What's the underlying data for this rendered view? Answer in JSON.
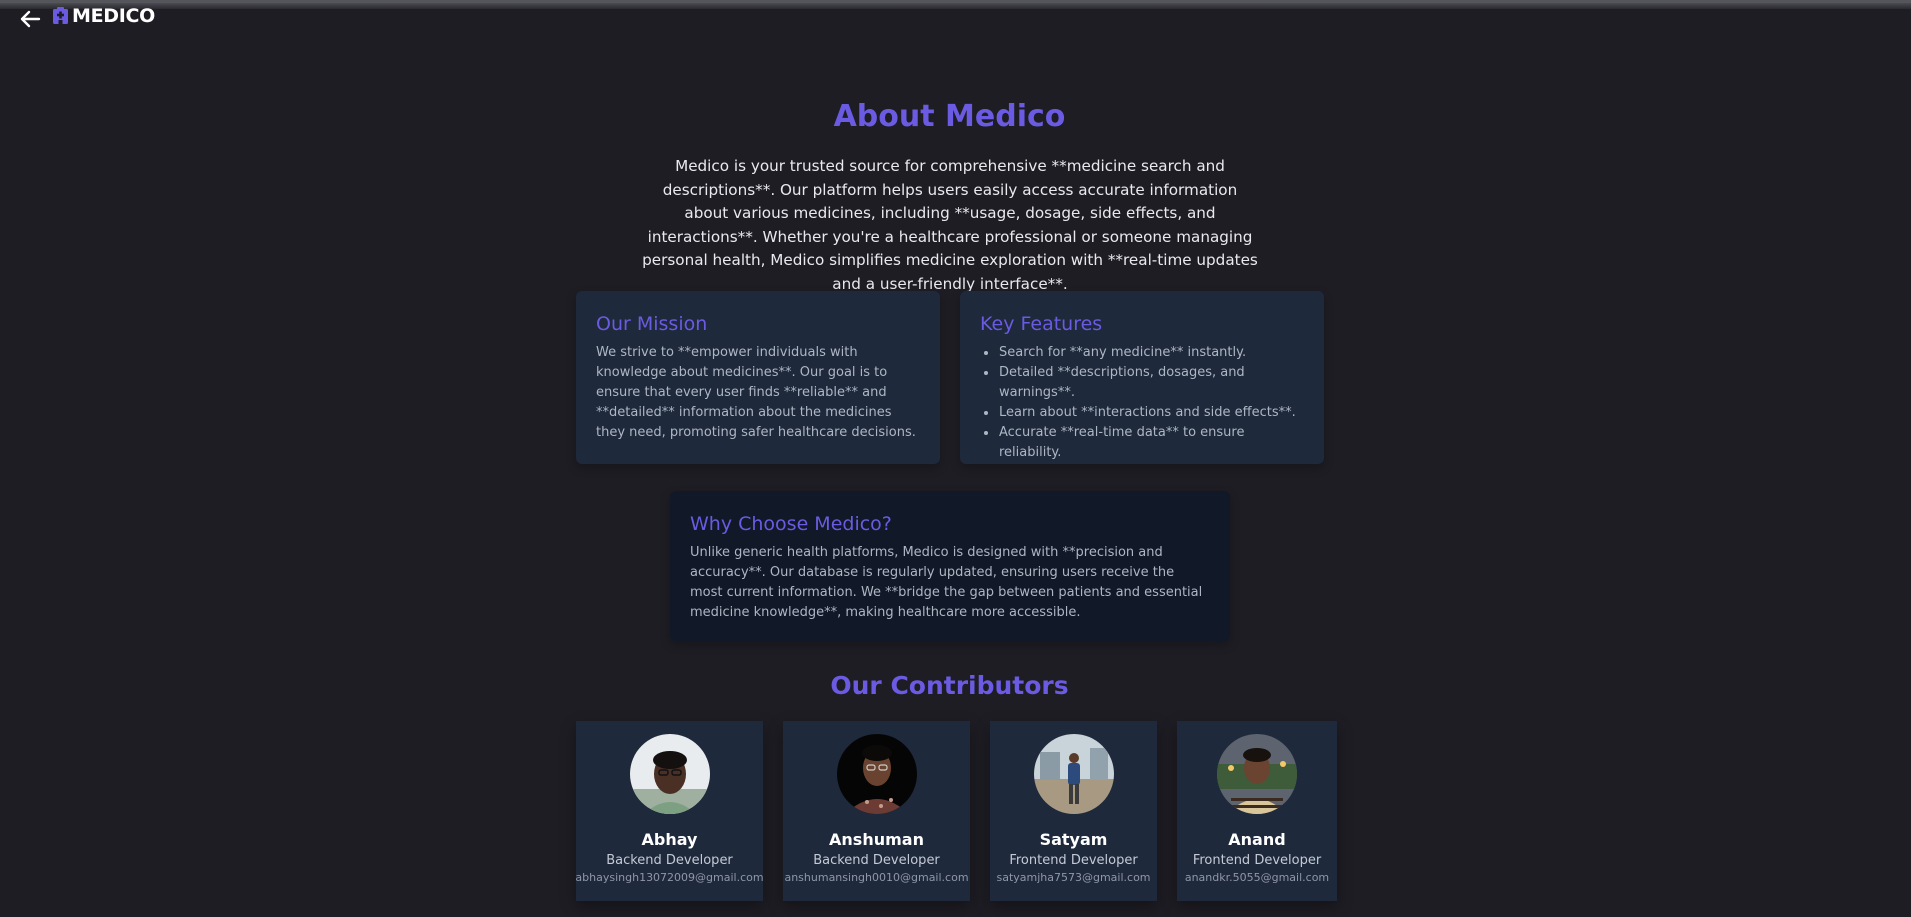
{
  "header": {
    "back_icon": "arrow-left-icon",
    "brand_icon": "hospital-icon",
    "brand_name": "MEDICO"
  },
  "about": {
    "title": "About Medico",
    "text": "Medico is your trusted source for comprehensive **medicine search and descriptions**. Our platform helps users easily access accurate information about various medicines, including **usage, dosage, side effects, and interactions**. Whether you're a healthcare professional or someone managing personal health, Medico simplifies medicine exploration with **real-time updates and a user-friendly interface**."
  },
  "mission": {
    "title": "Our Mission",
    "text": "We strive to **empower individuals with knowledge about medicines**. Our goal is to ensure that every user finds **reliable** and **detailed** information about the medicines they need, promoting safer healthcare decisions."
  },
  "features": {
    "title": "Key Features",
    "items": [
      "Search for **any medicine** instantly.",
      "Detailed **descriptions, dosages, and warnings**.",
      "Learn about **interactions and side effects**.",
      "Accurate **real-time data** to ensure reliability."
    ]
  },
  "why": {
    "title": "Why Choose Medico?",
    "text": "Unlike generic health platforms, Medico is designed with **precision and accuracy**. Our database is regularly updated, ensuring users receive the most current information. We **bridge the gap between patients and essential medicine knowledge**, making healthcare more accessible."
  },
  "contributors": {
    "title": "Our Contributors",
    "people": [
      {
        "name": "Abhay",
        "role": "Backend Developer",
        "email": "abhaysingh13072009@gmail.com"
      },
      {
        "name": "Anshuman",
        "role": "Backend Developer",
        "email": "anshumansingh0010@gmail.com"
      },
      {
        "name": "Satyam",
        "role": "Frontend Developer",
        "email": "satyamjha7573@gmail.com"
      },
      {
        "name": "Anand",
        "role": "Frontend Developer",
        "email": "anandkr.5055@gmail.com"
      }
    ]
  },
  "colors": {
    "background": "#1e1d24",
    "accent": "#6a5be2",
    "card": "#1e293b",
    "card_dark": "#111827"
  }
}
